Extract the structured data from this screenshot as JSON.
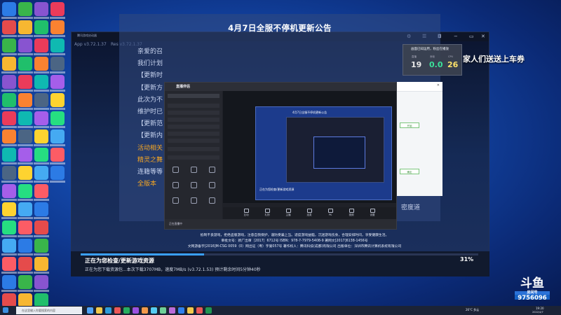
{
  "launcher": {
    "window_title": "腾讯游戏启动器",
    "app_version": "App v3.72.1.37",
    "res_version": "Res v3.72.1.37",
    "notice_title": "4月7日全服不停机更新公告",
    "notice_lines": [
      "亲爱的召",
      "我们计划",
      "【更新时",
      "【更新方",
      "此次为不",
      "维护时已",
      "【更新范",
      "【更新内",
      "活动相关",
      "精灵之舞",
      "连籍等等",
      "全版本"
    ],
    "watermark": "密度道",
    "streamer_text": "家人们送送上车券",
    "status": "正在为您检查/更新游戏资源",
    "detail": "正在为您下载资源包...本次下载3707MB，速度7MB/s (v3.72.1.53) 预计剩余时间5分钟40秒",
    "progress_percent": "31%",
    "progress_value": 0.31,
    "fine_print_1": "抵制不良游戏，拒绝盗版游戏，注意自我保护，谨防受骗上当。适度游戏益脑，沉迷游戏伤身，合理安排时间，享受健康生活。",
    "fine_print_2": "审批文号：新广出审［2017］6712号  ISBN：978-7-7979-5408-9  著网文[2017]6138-1456号",
    "fine_print_3": "文网游备字[2016]M-CSG 0059（0）网出证（粤）字第057号 著作权人：腾讯科技(成都)有限公司 出版单位：深圳市腾讯计算机系统有限公司"
  },
  "obs": {
    "logo": "直播伴侣",
    "bottom_text": "正在直播中",
    "controls": [
      "互动",
      "礼物",
      "主播",
      "连麦",
      "PK",
      "视频",
      "设置"
    ]
  },
  "overlay": {
    "title": "画面已知运用，粉丝在播放",
    "values": [
      "19",
      "0.0",
      "26"
    ]
  },
  "douyu": {
    "brand": "斗鱼",
    "label": "房间号",
    "room": "9756096"
  },
  "taskbar": {
    "search_placeholder": "在这里输入你要搜索的内容",
    "weather": "26°C 多云",
    "time": "19:20",
    "date": "2022/4/7"
  }
}
